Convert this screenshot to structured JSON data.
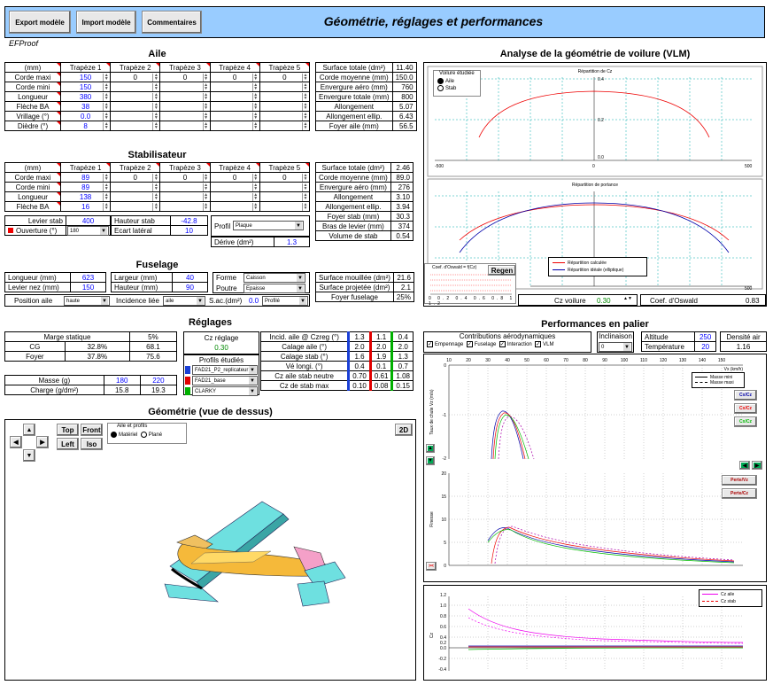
{
  "header": {
    "btn_export": "Export modèle",
    "btn_import": "Import modèle",
    "btn_comments": "Commentaires",
    "title": "Géométrie, réglages et performances",
    "brand": "EFProof"
  },
  "aile": {
    "title": "Aile",
    "cols": [
      "(mm)",
      "Trapèze 1",
      "Trapèze 2",
      "Trapèze 3",
      "Trapèze 4",
      "Trapèze 5"
    ],
    "rows": [
      [
        "Corde maxi",
        "150",
        "0",
        "0",
        "0",
        "0"
      ],
      [
        "Corde mini",
        "150",
        "",
        "",
        "",
        ""
      ],
      [
        "Longueur",
        "380",
        "",
        "",
        "",
        ""
      ],
      [
        "Flèche BA",
        "38",
        "",
        "",
        "",
        ""
      ],
      [
        "Vrillage (°)",
        "0.0",
        "",
        "",
        "",
        ""
      ],
      [
        "Dièdre (°)",
        "8",
        "",
        "",
        "",
        ""
      ]
    ],
    "stats": [
      [
        "Surface totale (dm²)",
        "11.40"
      ],
      [
        "Corde moyenne (mm)",
        "150.0"
      ],
      [
        "Envergure aéro (mm)",
        "760"
      ],
      [
        "Envergure totale (mm)",
        "800"
      ],
      [
        "Allongement",
        "5.07"
      ],
      [
        "Allongement ellip.",
        "6.43"
      ],
      [
        "Foyer aile (mm)",
        "56.5"
      ]
    ]
  },
  "stab": {
    "title": "Stabilisateur",
    "cols": [
      "(mm)",
      "Trapèze 1",
      "Trapèze 2",
      "Trapèze 3",
      "Trapèze 4",
      "Trapèze 5"
    ],
    "rows": [
      [
        "Corde maxi",
        "89",
        "0",
        "0",
        "0",
        "0"
      ],
      [
        "Corde mini",
        "89",
        "",
        "",
        "",
        ""
      ],
      [
        "Longueur",
        "138",
        "",
        "",
        "",
        ""
      ],
      [
        "Flèche BA",
        "16",
        "",
        "",
        "",
        ""
      ]
    ],
    "levier_label": "Levier stab",
    "levier": "400",
    "hauteur_label": "Hauteur stab",
    "hauteur": "-42.8",
    "ouverture_label": "Ouverture (°)",
    "ouverture": "180",
    "ecart_label": "Ecart latéral",
    "ecart": "10",
    "profil_label": "Profil",
    "profil": "Plaque",
    "derive_label": "Dérive (dm²)",
    "derive": "1.3",
    "stats": [
      [
        "Surface totale (dm²)",
        "2.46"
      ],
      [
        "Corde moyenne (mm)",
        "89.0"
      ],
      [
        "Envergure aéro (mm)",
        "276"
      ],
      [
        "Allongement",
        "3.10"
      ],
      [
        "Allongement ellip.",
        "3.94"
      ],
      [
        "Foyer stab (mm)",
        "30.3"
      ],
      [
        "Bras de levier (mm)",
        "374"
      ],
      [
        "Volume de stab",
        "0.54"
      ]
    ]
  },
  "fuselage": {
    "title": "Fuselage",
    "longueur_label": "Longueur (mm)",
    "longueur": "623",
    "levier_nez_label": "Levier nez (mm)",
    "levier_nez": "150",
    "largeur_label": "Largeur (mm)",
    "largeur": "40",
    "hauteur_label": "Hauteur (mm)",
    "hauteur": "90",
    "forme_label": "Forme",
    "forme": "Caisson",
    "poutre_label": "Poutre",
    "poutre": "Epaisse",
    "position_label": "Position aile",
    "position": "haute",
    "incidence_label": "Incidence liée",
    "incidence": "aile",
    "sac_label": "S.ac.(dm²)",
    "sac": "0.0",
    "sac_sel": "Profilé",
    "stats": [
      [
        "Surface mouillée (dm²)",
        "21.6"
      ],
      [
        "Surface projetée (dm²)",
        "2.1"
      ],
      [
        "Foyer fuselage",
        "25%"
      ]
    ]
  },
  "reglages": {
    "title": "Réglages",
    "marge_label": "Marge statique",
    "marge": "5%",
    "cg_label": "CG",
    "cg_pct": "32.8%",
    "cg_mm": "68.1",
    "foyer_label": "Foyer",
    "foyer_pct": "37.8%",
    "foyer_mm": "75.6",
    "masse_label": "Masse (g)",
    "masse1": "180",
    "masse2": "220",
    "charge_label": "Charge (g/dm²)",
    "charge1": "15.8",
    "charge2": "19.3",
    "cz_label": "Cz réglage",
    "cz": "0.30",
    "profils_label": "Profils étudiés",
    "profils": [
      "FAD21_P2_replicateur",
      "FAD21_base",
      "CLARKY"
    ],
    "profil_colors": [
      "#1a3fd6",
      "#e00000",
      "#00b000"
    ],
    "right_rows": [
      [
        "Incid. aile @ Czreg (°)",
        "1.3",
        "1.1",
        "0.4"
      ],
      [
        "Calage aile (°)",
        "2.0",
        "2.0",
        "2.0"
      ],
      [
        "Calage stab (°)",
        "1.6",
        "1.9",
        "1.3"
      ],
      [
        "Vé longi. (°)",
        "0.4",
        "0.1",
        "0.7"
      ],
      [
        "Cz aile stab neutre",
        "0.70",
        "0.61",
        "1.08"
      ],
      [
        "Cz de stab max",
        "0.10",
        "0.08",
        "0.15"
      ]
    ]
  },
  "geo3d": {
    "title": "Géométrie (vue de dessus)",
    "btn_top": "Top",
    "btn_front": "Front",
    "btn_left": "Left",
    "btn_iso": "Iso",
    "btn_2d": "2D",
    "affiche_label": "Aile et profils",
    "opt1": "Matériel",
    "opt2": "Plané"
  },
  "vlm": {
    "title": "Analyse de la géométrie de voilure (VLM)",
    "chart1_title": "Répartition de Cz",
    "chart2_title": "Répartition de portance",
    "sel_label": "Voilure étudiée",
    "sel_aile": "Aile",
    "sel_stab": "Stab",
    "legend_calc": "Répartition calculée",
    "legend_ideal": "Répartition idéale (elliptique)",
    "regen": "Regen",
    "oswald_small": "Coef. d'Oswald = f(Cz)",
    "cz_voilure_label": "Cz voilure",
    "cz_voilure": "0.30",
    "oswald_label": "Coef. d'Oswald",
    "oswald": "0.83",
    "y_ticks1": [
      "0.4",
      "0.2",
      "0.0"
    ],
    "x_ticks": [
      "-500",
      "0",
      "500"
    ],
    "small_ticks": [
      "0",
      "0.2",
      "0.4",
      "0.6",
      "0.8",
      "1",
      "1.2"
    ]
  },
  "perf": {
    "title": "Performances en palier",
    "contrib_label": "Contributions aérodynamiques",
    "cb_empennage": "Empennage",
    "cb_fuselage": "Fuselage",
    "cb_interaction": "Interaction",
    "cb_vlm": "VLM",
    "inclinaison_label": "Inclinaison",
    "inclinaison": "0",
    "altitude_label": "Altitude",
    "altitude": "250",
    "temperature_label": "Température",
    "temperature": "20",
    "densite_label": "Densité air",
    "densite": "1.16",
    "chart1_ylabel": "Taux de chute Vz (m/s)",
    "chart1_x_label": "Vx (km/h)",
    "legend_mini": "Masse mini",
    "legend_maxi": "Masse maxi",
    "btn_cd1": "Cx/Cz",
    "btn_cd2": "Cx/Cz",
    "btn_cd3": "Cx/Cz",
    "chart2_ylabel": "Finesse",
    "btn_f1": "Perte/Vz",
    "btn_f2": "Perte/Cz",
    "legend_cz_aile": "Cz aile",
    "legend_cz_stab": "Cz stab",
    "chart3_ylabel": "Cz",
    "x_ticks": [
      "10",
      "20",
      "30",
      "40",
      "50",
      "60",
      "70",
      "80",
      "90",
      "100",
      "110",
      "120",
      "130",
      "140",
      "150"
    ],
    "y1_ticks": [
      "0",
      "-1",
      "-2"
    ],
    "y2_ticks": [
      "20",
      "15",
      "10",
      "5",
      "0"
    ],
    "y3_ticks": [
      "1.2",
      "1.0",
      "0.8",
      "0.6",
      "0.4",
      "0.2",
      "0.0",
      "-0.2",
      "-0.4"
    ]
  }
}
